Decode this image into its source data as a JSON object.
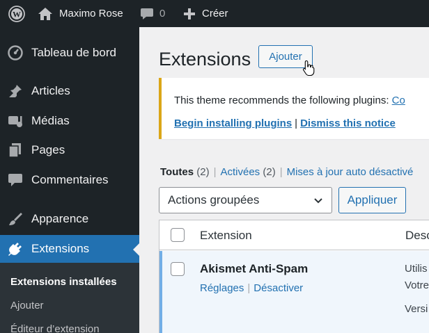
{
  "admin_bar": {
    "site_name": "Maximo Rose",
    "comments_count": "0",
    "new_label": "Créer"
  },
  "sidebar": {
    "items": [
      {
        "label": "Tableau de bord",
        "icon": "dashboard-icon"
      },
      {
        "label": "Articles",
        "icon": "pushpin-icon"
      },
      {
        "label": "Médias",
        "icon": "media-icon"
      },
      {
        "label": "Pages",
        "icon": "pages-icon"
      },
      {
        "label": "Commentaires",
        "icon": "comment-icon"
      },
      {
        "label": "Apparence",
        "icon": "paintbrush-icon"
      },
      {
        "label": "Extensions",
        "icon": "plugin-icon",
        "active": true
      }
    ],
    "submenu": [
      {
        "label": "Extensions installées",
        "current": true
      },
      {
        "label": "Ajouter"
      },
      {
        "label": "Éditeur d’extension"
      }
    ]
  },
  "main": {
    "title": "Extensions",
    "add_button": "Ajouter",
    "notice": {
      "text": "This theme recommends the following plugins: ",
      "text_link": "Co",
      "begin_link": "Begin installing plugins",
      "separator": "|",
      "dismiss_link": "Dismiss this notice"
    },
    "filters": {
      "all_label": "Toutes",
      "all_count": "(2)",
      "active_label": "Activées",
      "active_count": "(2)",
      "auto_updates_label": "Mises à jour auto désactivé"
    },
    "bulk_actions": {
      "selected": "Actions groupées",
      "apply": "Appliquer"
    },
    "table": {
      "col_extension": "Extension",
      "col_description": "Desc",
      "rows": [
        {
          "name": "Akismet Anti-Spam",
          "action_settings": "Réglages",
          "action_deactivate": "Désactiver",
          "desc_line1": "Utilis",
          "desc_line2": "Votre",
          "desc_line3": "Versi"
        }
      ]
    }
  },
  "colors": {
    "admin_dark": "#1d2327",
    "accent": "#2271b1",
    "notice_warning": "#dba617",
    "active_row_border": "#72aee6"
  }
}
